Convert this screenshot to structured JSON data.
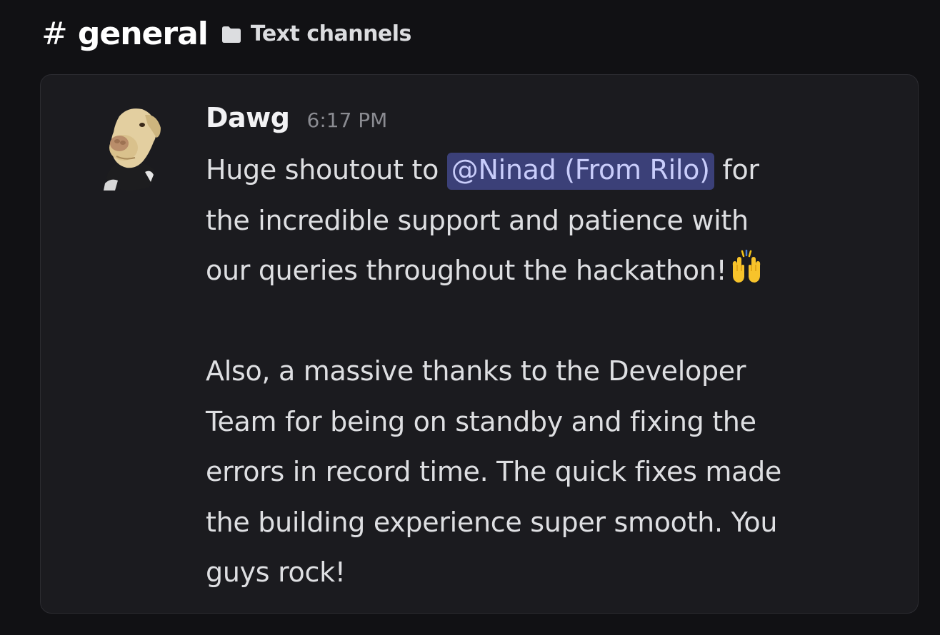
{
  "channel": {
    "hash_symbol": "#",
    "name": "general",
    "category_icon": "folder-icon",
    "category": "Text channels"
  },
  "message": {
    "author": "Dawg",
    "timestamp": "6:17 PM",
    "avatar_icon": "dog-avatar",
    "line1_prefix": "Huge shoutout to ",
    "mention": "@Ninad (From Rilo)",
    "line1_suffix": " for",
    "line2": "the incredible support and patience with",
    "line3": "our queries throughout the hackathon!",
    "line3_emoji": "raising-hands-emoji",
    "line4": "Also, a massive thanks to the Developer",
    "line5": "Team for being on standby and fixing the",
    "line6": "errors in record time. The quick fixes made",
    "line7": "the building experience super smooth. You",
    "line8": "guys rock!"
  },
  "colors": {
    "background": "#111114",
    "card": "#1b1b1f",
    "mention_bg": "#3b4078",
    "mention_text": "#c9cdfb",
    "timestamp": "#8a8b91"
  }
}
